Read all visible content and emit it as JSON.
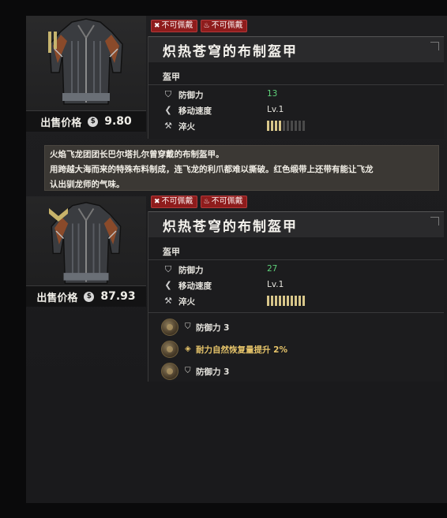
{
  "items": [
    {
      "tags": [
        "不可佩戴",
        "不可佩戴"
      ],
      "name": "炽热苍穹的布制盔甲",
      "type": "盔甲",
      "stats": [
        {
          "icon": "shield-icon",
          "label": "防御力",
          "value": "13"
        },
        {
          "icon": "wing-icon",
          "label": "移动速度",
          "value": "Lv.1"
        },
        {
          "icon": "hammer-icon",
          "label": "淬火",
          "level_filled": 4,
          "level_total": 10
        }
      ],
      "price_label": "出售价格",
      "price_value": "9.80",
      "description": [
        "火焰飞龙团团长巴尔塔扎尔曾穿戴的布制盔甲。",
        "用跨越大海而来的特殊布料制成，连飞龙的利爪都难以撕破。红色缎带上还带有能让飞龙",
        "认出驯龙师的气味。"
      ]
    },
    {
      "tags": [
        "不可佩戴",
        "不可佩戴"
      ],
      "name": "炽热苍穹的布制盔甲",
      "type": "盔甲",
      "stats": [
        {
          "icon": "shield-icon",
          "label": "防御力",
          "value": "27"
        },
        {
          "icon": "wing-icon",
          "label": "移动速度",
          "value": "Lv.1"
        },
        {
          "icon": "hammer-icon",
          "label": "淬火",
          "level_filled": 10,
          "level_total": 10
        }
      ],
      "price_label": "出售价格",
      "price_value": "87.93",
      "bonuses": [
        {
          "icon": "shield-icon",
          "text": "防御力 3",
          "highlight": false
        },
        {
          "icon": "diamond-icon",
          "text": "耐力自然恢复量提升 2%",
          "highlight": true
        },
        {
          "icon": "shield-icon",
          "text": "防御力 3",
          "highlight": false
        }
      ]
    }
  ],
  "colors": {
    "tag_bg": "#8e1c1c",
    "defense_value": "#5fd17a",
    "bar_on": "#d8c68a",
    "bonus_gold": "#e6c46a"
  }
}
